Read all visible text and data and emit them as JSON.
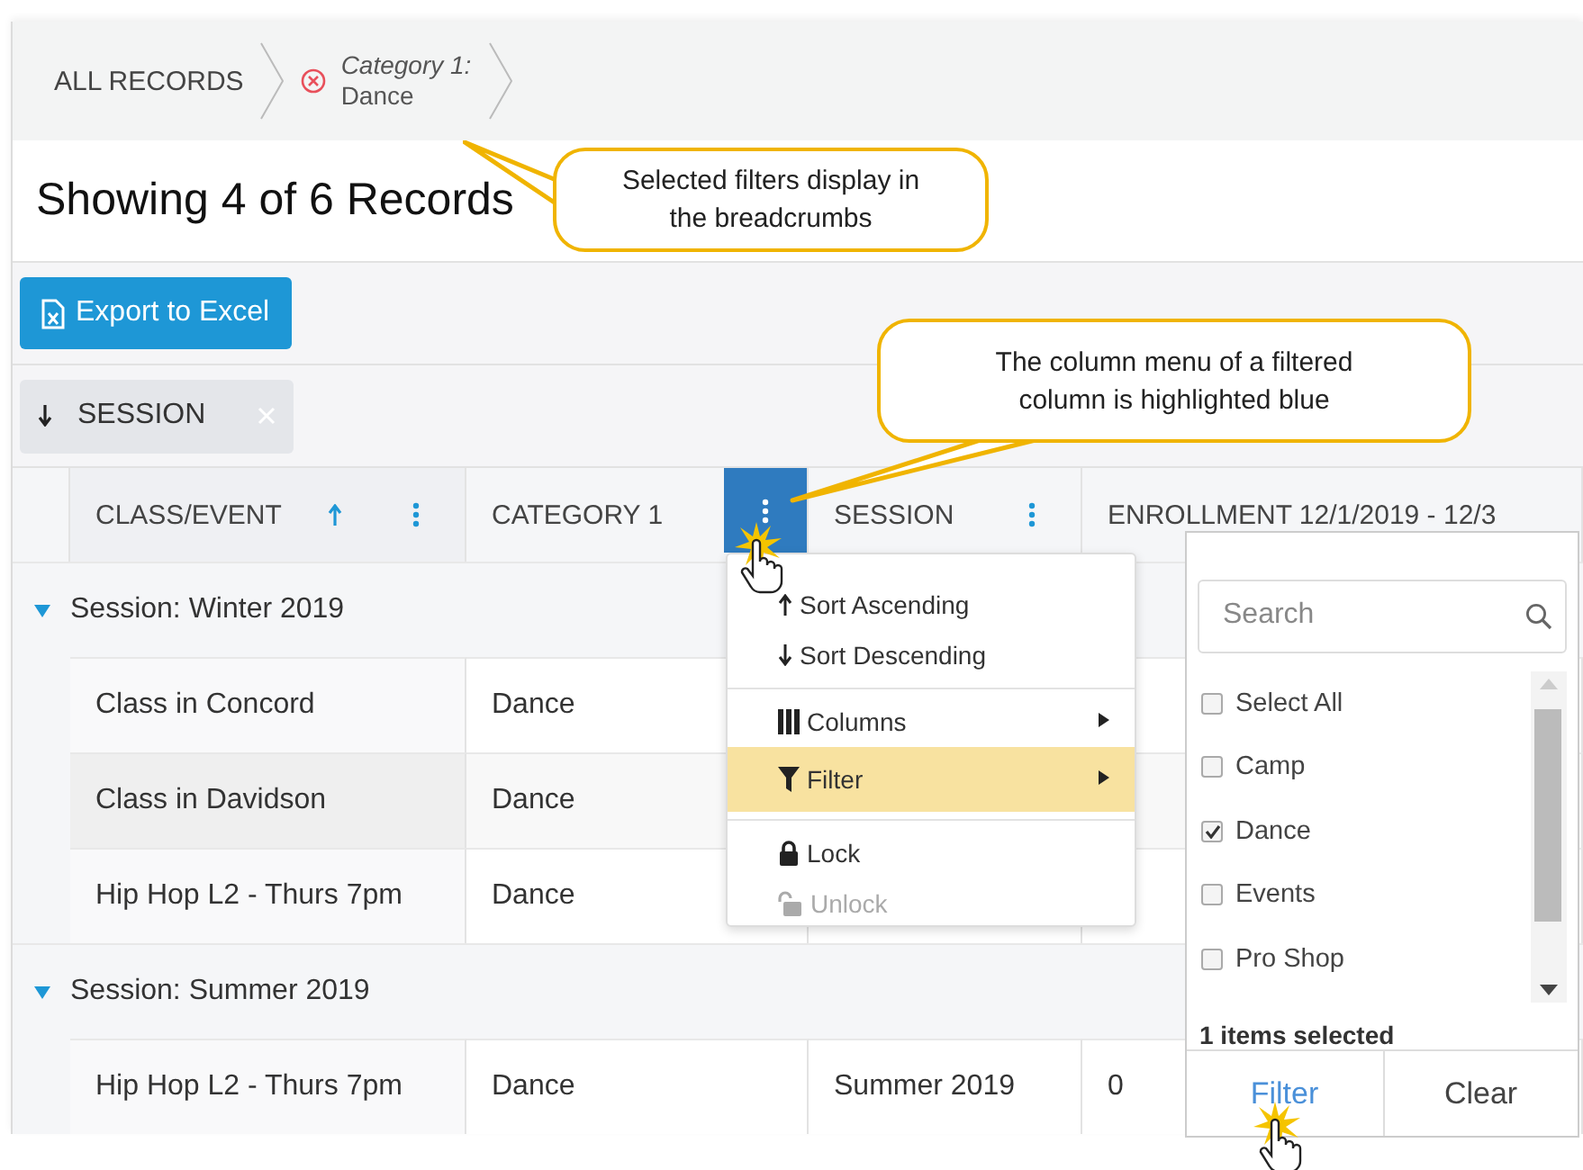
{
  "breadcrumbs": [
    {
      "kind": "root",
      "label": "ALL RECORDS"
    },
    {
      "kind": "filter",
      "label": "Category 1:",
      "value": "Dance"
    }
  ],
  "title": "Showing 4 of 6 Records",
  "toolbar": {
    "export_button": "Export to Excel"
  },
  "grouping": [
    {
      "label": "SESSION",
      "sort_descending": true
    }
  ],
  "columns": [
    {
      "label": "CLASS/EVENT",
      "sort_ascending": true,
      "menu_button": {
        "highlighted": false
      }
    },
    {
      "label": "CATEGORY 1",
      "sort_ascending": false,
      "menu_button": {
        "highlighted": true
      }
    },
    {
      "label": "SESSION",
      "sort_ascending": false,
      "menu_button": {
        "highlighted": false
      }
    },
    {
      "label": "ENROLLMENT 12/1/2019 - 12/3",
      "sort_ascending": false
    }
  ],
  "groups": [
    {
      "label": "Session: Winter 2019",
      "expanded": true,
      "rows": [
        {
          "cells": [
            "Class in Concord",
            "Dance"
          ],
          "highlighted": false
        },
        {
          "cells": [
            "Class in Davidson",
            "Dance"
          ],
          "highlighted": true
        },
        {
          "cells": [
            "Hip Hop L2 - Thurs 7pm",
            "Dance"
          ],
          "highlighted": false
        }
      ]
    },
    {
      "label": "Session: Summer 2019",
      "expanded": true,
      "rows": [
        {
          "cells": [
            "Hip Hop L2 - Thurs 7pm",
            "Dance",
            "Summer 2019",
            "0"
          ],
          "highlighted": false
        }
      ]
    }
  ],
  "column_menu": {
    "sections": [
      [
        {
          "label": "Sort Ascending",
          "submenu": false,
          "highlighted": false,
          "disabled": false
        },
        {
          "label": "Sort Descending",
          "submenu": false,
          "highlighted": false,
          "disabled": false
        }
      ],
      [
        {
          "label": "Columns",
          "submenu": true,
          "highlighted": false,
          "disabled": false
        },
        {
          "label": "Filter",
          "submenu": true,
          "highlighted": true,
          "disabled": false
        }
      ],
      [
        {
          "label": "Lock",
          "submenu": false,
          "highlighted": false,
          "disabled": false
        },
        {
          "label": "Unlock",
          "submenu": false,
          "highlighted": false,
          "disabled": true
        }
      ]
    ]
  },
  "filter_panel": {
    "search": {
      "placeholder": "Search"
    },
    "options": [
      {
        "label": "Select All",
        "checked": false
      },
      {
        "label": "Camp",
        "checked": false
      },
      {
        "label": "Dance",
        "checked": true
      },
      {
        "label": "Events",
        "checked": false
      },
      {
        "label": "Pro Shop",
        "checked": false
      }
    ],
    "status": "1 items selected",
    "buttons": [
      {
        "label": "Filter",
        "primary": true
      },
      {
        "label": "Clear",
        "primary": false
      }
    ]
  },
  "callouts": [
    {
      "text": "Selected filters display in the breadcrumbs"
    },
    {
      "text": "The column menu of a filtered column is highlighted blue"
    }
  ]
}
